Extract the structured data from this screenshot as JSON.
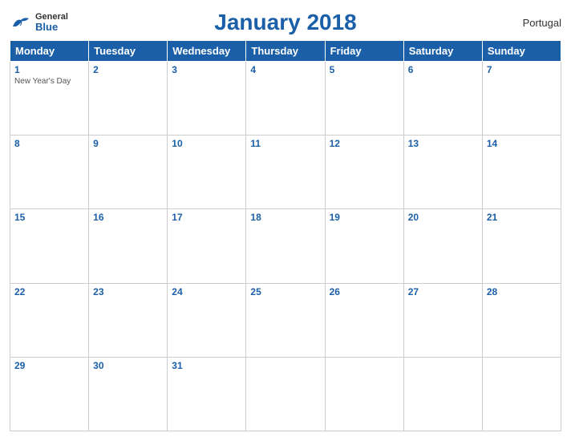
{
  "header": {
    "logo": {
      "line1": "General",
      "line2": "Blue"
    },
    "title": "January 2018",
    "country": "Portugal"
  },
  "weekdays": [
    "Monday",
    "Tuesday",
    "Wednesday",
    "Thursday",
    "Friday",
    "Saturday",
    "Sunday"
  ],
  "weeks": [
    [
      {
        "day": "1",
        "holiday": "New Year's Day"
      },
      {
        "day": "2",
        "holiday": ""
      },
      {
        "day": "3",
        "holiday": ""
      },
      {
        "day": "4",
        "holiday": ""
      },
      {
        "day": "5",
        "holiday": ""
      },
      {
        "day": "6",
        "holiday": ""
      },
      {
        "day": "7",
        "holiday": ""
      }
    ],
    [
      {
        "day": "8",
        "holiday": ""
      },
      {
        "day": "9",
        "holiday": ""
      },
      {
        "day": "10",
        "holiday": ""
      },
      {
        "day": "11",
        "holiday": ""
      },
      {
        "day": "12",
        "holiday": ""
      },
      {
        "day": "13",
        "holiday": ""
      },
      {
        "day": "14",
        "holiday": ""
      }
    ],
    [
      {
        "day": "15",
        "holiday": ""
      },
      {
        "day": "16",
        "holiday": ""
      },
      {
        "day": "17",
        "holiday": ""
      },
      {
        "day": "18",
        "holiday": ""
      },
      {
        "day": "19",
        "holiday": ""
      },
      {
        "day": "20",
        "holiday": ""
      },
      {
        "day": "21",
        "holiday": ""
      }
    ],
    [
      {
        "day": "22",
        "holiday": ""
      },
      {
        "day": "23",
        "holiday": ""
      },
      {
        "day": "24",
        "holiday": ""
      },
      {
        "day": "25",
        "holiday": ""
      },
      {
        "day": "26",
        "holiday": ""
      },
      {
        "day": "27",
        "holiday": ""
      },
      {
        "day": "28",
        "holiday": ""
      }
    ],
    [
      {
        "day": "29",
        "holiday": ""
      },
      {
        "day": "30",
        "holiday": ""
      },
      {
        "day": "31",
        "holiday": ""
      },
      {
        "day": "",
        "holiday": ""
      },
      {
        "day": "",
        "holiday": ""
      },
      {
        "day": "",
        "holiday": ""
      },
      {
        "day": "",
        "holiday": ""
      }
    ]
  ]
}
